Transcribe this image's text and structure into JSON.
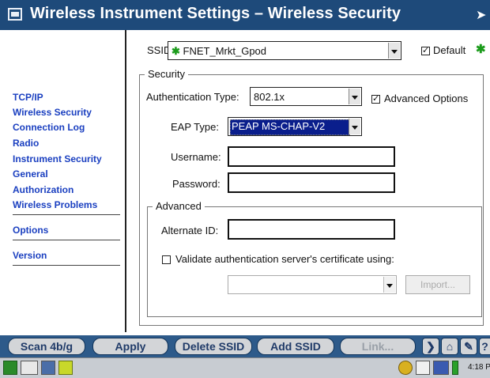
{
  "window": {
    "title": "Wireless Instrument Settings – Wireless Security"
  },
  "sidebar": {
    "items": [
      {
        "label": "TCP/IP"
      },
      {
        "label": "Wireless Security"
      },
      {
        "label": "Connection Log"
      },
      {
        "label": "Radio"
      },
      {
        "label": "Instrument Security"
      },
      {
        "label": "General"
      },
      {
        "label": "Authorization"
      },
      {
        "label": "Wireless Problems"
      },
      {
        "label": "Options"
      },
      {
        "label": "Version"
      }
    ]
  },
  "ssid": {
    "label": "SSID:",
    "value": "FNET_Mrkt_Gpod",
    "default_label": "Default",
    "default_checked": true
  },
  "security": {
    "legend": "Security",
    "auth_type_label": "Authentication Type:",
    "auth_type_value": "802.1x",
    "advanced_options_label": "Advanced Options",
    "advanced_options_checked": true,
    "eap_type_label": "EAP Type:",
    "eap_type_value": "PEAP MS-CHAP-V2",
    "username_label": "Username:",
    "username_value": "",
    "password_label": "Password:",
    "password_value": ""
  },
  "advanced": {
    "legend": "Advanced",
    "alternate_id_label": "Alternate ID:",
    "alternate_id_value": "",
    "validate_label": "Validate authentication server's certificate using:",
    "validate_checked": false,
    "certificate_value": "",
    "import_label": "Import..."
  },
  "toolbar": {
    "scan_label": "Scan 4b/g",
    "apply_label": "Apply",
    "delete_label": "Delete SSID",
    "add_label": "Add SSID",
    "link_label": "Link..."
  },
  "taskbar": {
    "clock": "4:18 P"
  },
  "colors": {
    "title_bar": "#1e4a7a",
    "nav_link": "#1a3fc0",
    "selection": "#0a1e8c",
    "toolbar": "#2d5a8a",
    "star": "#1b9b1b"
  }
}
